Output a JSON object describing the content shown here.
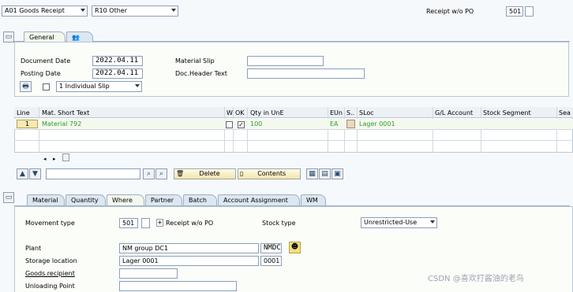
{
  "header": {
    "action_value": "A01 Goods Receipt",
    "reference_value": "R10 Other",
    "movement_label": "Receipt w/o PO",
    "movement_code": "501"
  },
  "top_tabs": [
    {
      "label": "General",
      "active": true
    },
    {
      "label": "",
      "icon": "people-icon",
      "active": false
    }
  ],
  "general": {
    "document_date_label": "Document Date",
    "document_date_value": "2022.04.11",
    "posting_date_label": "Posting Date",
    "posting_date_value": "2022.04.11",
    "material_slip_label": "Material Slip",
    "material_slip_value": "",
    "doc_header_text_label": "Doc.Header Text",
    "doc_header_text_value": "",
    "print_option": "1 Individual Slip"
  },
  "items_table": {
    "columns": [
      "Line",
      "Mat. Short Text",
      "W",
      "OK",
      "Qty in UnE",
      "EUn",
      "S..",
      "SLoc",
      "G/L Account",
      "Stock Segment",
      "Sea"
    ],
    "rows": [
      {
        "line": "1",
        "material": "Material 792",
        "ok": true,
        "qty": "100",
        "eun": "EA",
        "sloc": "Lager 0001",
        "gl_account": "",
        "stock_segment": ""
      }
    ]
  },
  "toolbar": {
    "delete_label": "Delete",
    "contents_label": "Contents",
    "search_value": ""
  },
  "detail_tabs": [
    {
      "label": "Material",
      "active": false
    },
    {
      "label": "Quantity",
      "active": false
    },
    {
      "label": "Where",
      "active": true
    },
    {
      "label": "Partner",
      "active": false
    },
    {
      "label": "Batch",
      "active": false
    },
    {
      "label": "Account Assignment",
      "active": false
    },
    {
      "label": "WM",
      "active": false
    }
  ],
  "where": {
    "movement_type_label": "Movement type",
    "movement_type_value": "501",
    "movement_type_text": "Receipt w/o PO",
    "stock_type_label": "Stock type",
    "stock_type_value": "Unrestricted-Use",
    "plant_label": "Plant",
    "plant_value": "NM group DC1",
    "plant_code": "NMDC",
    "storage_location_label": "Storage location",
    "storage_location_value": "Lager 0001",
    "storage_location_code": "0001",
    "goods_recipient_label": "Goods recipient",
    "goods_recipient_value": "",
    "unloading_point_label": "Unloading Point",
    "unloading_point_value": ""
  },
  "watermark": "CSDN @喜欢打酱油的老鸟",
  "colors": {
    "accent_green": "#2e9b2e",
    "button_gold": "#f2e4a8",
    "tab_blue": "#dde7f1"
  }
}
